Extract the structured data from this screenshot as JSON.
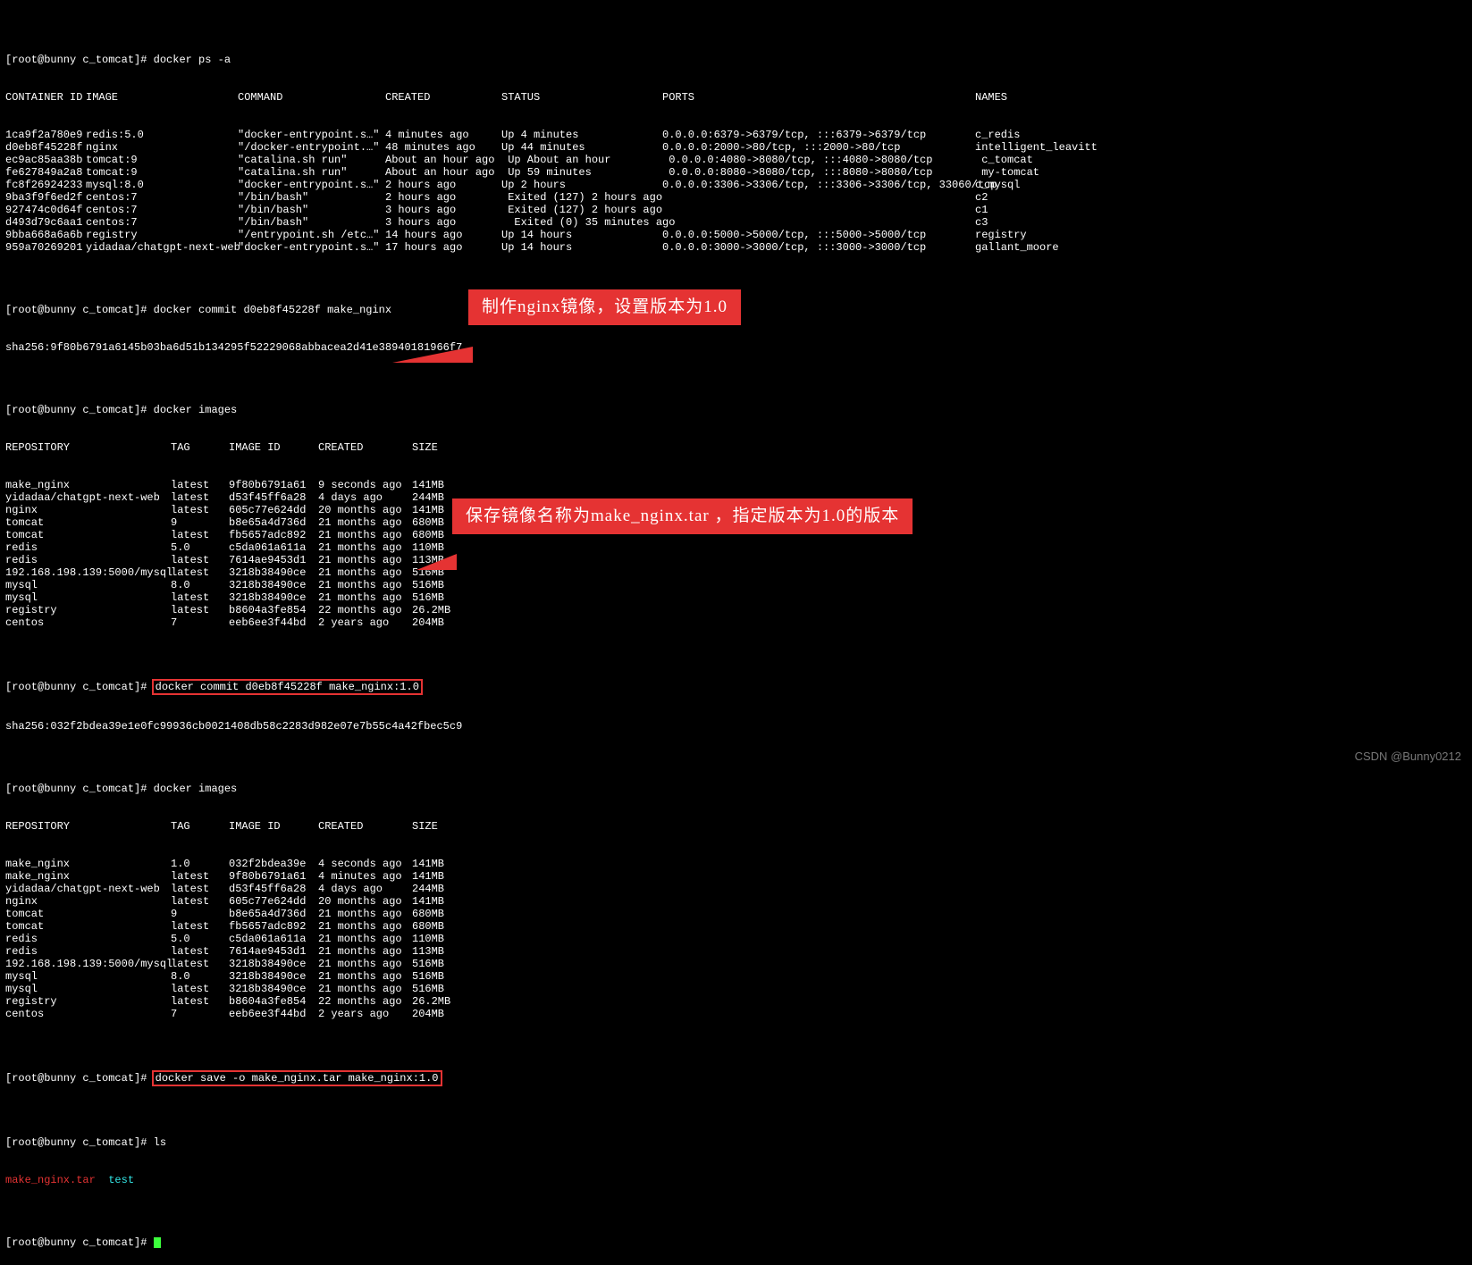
{
  "prompt_user": "[root@bunny c_tomcat]# ",
  "cmd_ps": "docker ps -a",
  "ps_header": {
    "ci": "CONTAINER ID",
    "img": "IMAGE",
    "cmd": "COMMAND",
    "cre": "CREATED",
    "sta": "STATUS",
    "por": "PORTS",
    "nam": "NAMES"
  },
  "ps_rows": [
    {
      "ci": "1ca9f2a780e9",
      "img": "redis:5.0",
      "cmd": "\"docker-entrypoint.s…\"",
      "cre": "4 minutes ago",
      "sta": "Up 4 minutes",
      "por": "0.0.0.0:6379->6379/tcp, :::6379->6379/tcp",
      "nam": "c_redis"
    },
    {
      "ci": "d0eb8f45228f",
      "img": "nginx",
      "cmd": "\"/docker-entrypoint.…\"",
      "cre": "48 minutes ago",
      "sta": "Up 44 minutes",
      "por": "0.0.0.0:2000->80/tcp, :::2000->80/tcp",
      "nam": "intelligent_leavitt"
    },
    {
      "ci": "ec9ac85aa38b",
      "img": "tomcat:9",
      "cmd": "\"catalina.sh run\"",
      "cre": "About an hour ago",
      "sta": " Up About an hour",
      "por": " 0.0.0.0:4080->8080/tcp, :::4080->8080/tcp",
      "nam": " c_tomcat"
    },
    {
      "ci": "fe627849a2a8",
      "img": "tomcat:9",
      "cmd": "\"catalina.sh run\"",
      "cre": "About an hour ago",
      "sta": " Up 59 minutes",
      "por": " 0.0.0.0:8080->8080/tcp, :::8080->8080/tcp",
      "nam": " my-tomcat"
    },
    {
      "ci": "fc8f26924233",
      "img": "mysql:8.0",
      "cmd": "\"docker-entrypoint.s…\"",
      "cre": "2 hours ago",
      "sta": "Up 2 hours",
      "por": "0.0.0.0:3306->3306/tcp, :::3306->3306/tcp, 33060/tcp",
      "nam": "c_mysql"
    },
    {
      "ci": "9ba3f9f6ed2f",
      "img": "centos:7",
      "cmd": "\"/bin/bash\"",
      "cre": "2 hours ago",
      "sta": " Exited (127) 2 hours ago",
      "por": "",
      "nam": "c2"
    },
    {
      "ci": "927474c0d64f",
      "img": "centos:7",
      "cmd": "\"/bin/bash\"",
      "cre": "3 hours ago",
      "sta": " Exited (127) 2 hours ago",
      "por": "",
      "nam": "c1"
    },
    {
      "ci": "d493d79c6aa1",
      "img": "centos:7",
      "cmd": "\"/bin/bash\"",
      "cre": "3 hours ago",
      "sta": "  Exited (0) 35 minutes ago",
      "por": "",
      "nam": "c3"
    },
    {
      "ci": "9bba668a6a6b",
      "img": "registry",
      "cmd": "\"/entrypoint.sh /etc…\"",
      "cre": "14 hours ago",
      "sta": "Up 14 hours",
      "por": "0.0.0.0:5000->5000/tcp, :::5000->5000/tcp",
      "nam": "registry"
    },
    {
      "ci": "959a70269201",
      "img": "yidadaa/chatgpt-next-web",
      "cmd": "\"docker-entrypoint.s…\"",
      "cre": "17 hours ago",
      "sta": "Up 14 hours",
      "por": "0.0.0.0:3000->3000/tcp, :::3000->3000/tcp",
      "nam": "gallant_moore"
    }
  ],
  "cmd_commit1": "docker commit d0eb8f45228f make_nginx",
  "sha_commit1": "sha256:9f80b6791a6145b03ba6d51b134295f52229068abbacea2d41e38940181966f7",
  "cmd_images1": "docker images",
  "img_header": {
    "repo": "REPOSITORY",
    "tag": "TAG",
    "iid": "IMAGE ID",
    "cre": "CREATED",
    "size": "SIZE"
  },
  "images1": [
    {
      "repo": "make_nginx",
      "tag": "latest",
      "iid": "9f80b6791a61",
      "cre": "9 seconds ago",
      "size": "141MB"
    },
    {
      "repo": "yidadaa/chatgpt-next-web",
      "tag": "latest",
      "iid": "d53f45ff6a28",
      "cre": "4 days ago",
      "size": "244MB"
    },
    {
      "repo": "nginx",
      "tag": "latest",
      "iid": "605c77e624dd",
      "cre": "20 months ago",
      "size": "141MB"
    },
    {
      "repo": "tomcat",
      "tag": "9",
      "iid": "b8e65a4d736d",
      "cre": "21 months ago",
      "size": "680MB"
    },
    {
      "repo": "tomcat",
      "tag": "latest",
      "iid": "fb5657adc892",
      "cre": "21 months ago",
      "size": "680MB"
    },
    {
      "repo": "redis",
      "tag": "5.0",
      "iid": "c5da061a611a",
      "cre": "21 months ago",
      "size": "110MB"
    },
    {
      "repo": "redis",
      "tag": "latest",
      "iid": "7614ae9453d1",
      "cre": "21 months ago",
      "size": "113MB"
    },
    {
      "repo": "192.168.198.139:5000/mysql",
      "tag": "latest",
      "iid": "3218b38490ce",
      "cre": "21 months ago",
      "size": "516MB"
    },
    {
      "repo": "mysql",
      "tag": "8.0",
      "iid": "3218b38490ce",
      "cre": "21 months ago",
      "size": "516MB"
    },
    {
      "repo": "mysql",
      "tag": "latest",
      "iid": "3218b38490ce",
      "cre": "21 months ago",
      "size": "516MB"
    },
    {
      "repo": "registry",
      "tag": "latest",
      "iid": "b8604a3fe854",
      "cre": "22 months ago",
      "size": "26.2MB"
    },
    {
      "repo": "centos",
      "tag": "7",
      "iid": "eeb6ee3f44bd",
      "cre": "2 years ago",
      "size": "204MB"
    }
  ],
  "cmd_commit2": "docker commit d0eb8f45228f make_nginx:1.0",
  "sha_commit2": "sha256:032f2bdea39e1e0fc99936cb0021408db58c2283d982e07e7b55c4a42fbec5c9",
  "cmd_images2": "docker images",
  "images2": [
    {
      "repo": "make_nginx",
      "tag": "1.0",
      "iid": "032f2bdea39e",
      "cre": "4 seconds ago",
      "size": "141MB"
    },
    {
      "repo": "make_nginx",
      "tag": "latest",
      "iid": "9f80b6791a61",
      "cre": "4 minutes ago",
      "size": "141MB"
    },
    {
      "repo": "yidadaa/chatgpt-next-web",
      "tag": "latest",
      "iid": "d53f45ff6a28",
      "cre": "4 days ago",
      "size": "244MB"
    },
    {
      "repo": "nginx",
      "tag": "latest",
      "iid": "605c77e624dd",
      "cre": "20 months ago",
      "size": "141MB"
    },
    {
      "repo": "tomcat",
      "tag": "9",
      "iid": "b8e65a4d736d",
      "cre": "21 months ago",
      "size": "680MB"
    },
    {
      "repo": "tomcat",
      "tag": "latest",
      "iid": "fb5657adc892",
      "cre": "21 months ago",
      "size": "680MB"
    },
    {
      "repo": "redis",
      "tag": "5.0",
      "iid": "c5da061a611a",
      "cre": "21 months ago",
      "size": "110MB"
    },
    {
      "repo": "redis",
      "tag": "latest",
      "iid": "7614ae9453d1",
      "cre": "21 months ago",
      "size": "113MB"
    },
    {
      "repo": "192.168.198.139:5000/mysql",
      "tag": "latest",
      "iid": "3218b38490ce",
      "cre": "21 months ago",
      "size": "516MB"
    },
    {
      "repo": "mysql",
      "tag": "8.0",
      "iid": "3218b38490ce",
      "cre": "21 months ago",
      "size": "516MB"
    },
    {
      "repo": "mysql",
      "tag": "latest",
      "iid": "3218b38490ce",
      "cre": "21 months ago",
      "size": "516MB"
    },
    {
      "repo": "registry",
      "tag": "latest",
      "iid": "b8604a3fe854",
      "cre": "22 months ago",
      "size": "26.2MB"
    },
    {
      "repo": "centos",
      "tag": "7",
      "iid": "eeb6ee3f44bd",
      "cre": "2 years ago",
      "size": "204MB"
    }
  ],
  "cmd_save": "docker save -o make_nginx.tar make_nginx:1.0",
  "cmd_ls": "ls",
  "ls_file1": "make_nginx.tar",
  "ls_file2": "test",
  "callout1": "制作nginx镜像，设置版本为1.0",
  "callout2": "保存镜像名称为make_nginx.tar ，指定版本为1.0的版本",
  "watermark": "CSDN @Bunny0212"
}
